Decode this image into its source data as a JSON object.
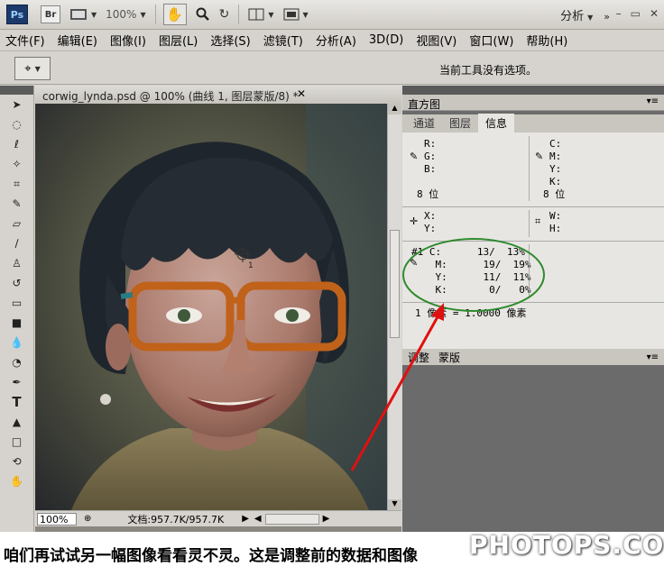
{
  "appbar": {
    "ps_logo": "Ps",
    "br_logo": "Br",
    "zoom": "100%",
    "workspace": "分析"
  },
  "menubar": {
    "items": [
      "文件(F)",
      "编辑(E)",
      "图像(I)",
      "图层(L)",
      "选择(S)",
      "滤镜(T)",
      "分析(A)",
      "3D(D)",
      "视图(V)",
      "窗口(W)",
      "帮助(H)"
    ]
  },
  "options": {
    "message": "当前工具没有选项。"
  },
  "document": {
    "tab_title": "corwig_lynda.psd @ 100% (曲线 1, 图层蒙版/8) *",
    "zoom_value": "100%",
    "doc_size": "文档:957.7K/957.7K"
  },
  "panels": {
    "histogram_tab": "直方图",
    "tabs": [
      "通道",
      "图层",
      "信息"
    ],
    "info": {
      "rgb_labels": "R:\nG:\nB:",
      "cmyk_labels": "C:\nM:\nY:\nK:",
      "bit_left": "8 位",
      "bit_right": "8 位",
      "xy_labels": "X:\nY:",
      "wh_labels": "W:\nH:",
      "sample": "#1 C:      13/  13%\n    M:      19/  19%\n    Y:      11/  11%\n    K:       0/   0%",
      "pixel_ratio": "1 像素 = 1.0000 像素"
    },
    "lower_tabs": [
      "调整",
      "蒙版"
    ]
  },
  "caption": {
    "text": "咱们再试试另一幅图像看看灵不灵。这是调整前的数据和图像",
    "watermark": "PHOTOPS.COM"
  }
}
